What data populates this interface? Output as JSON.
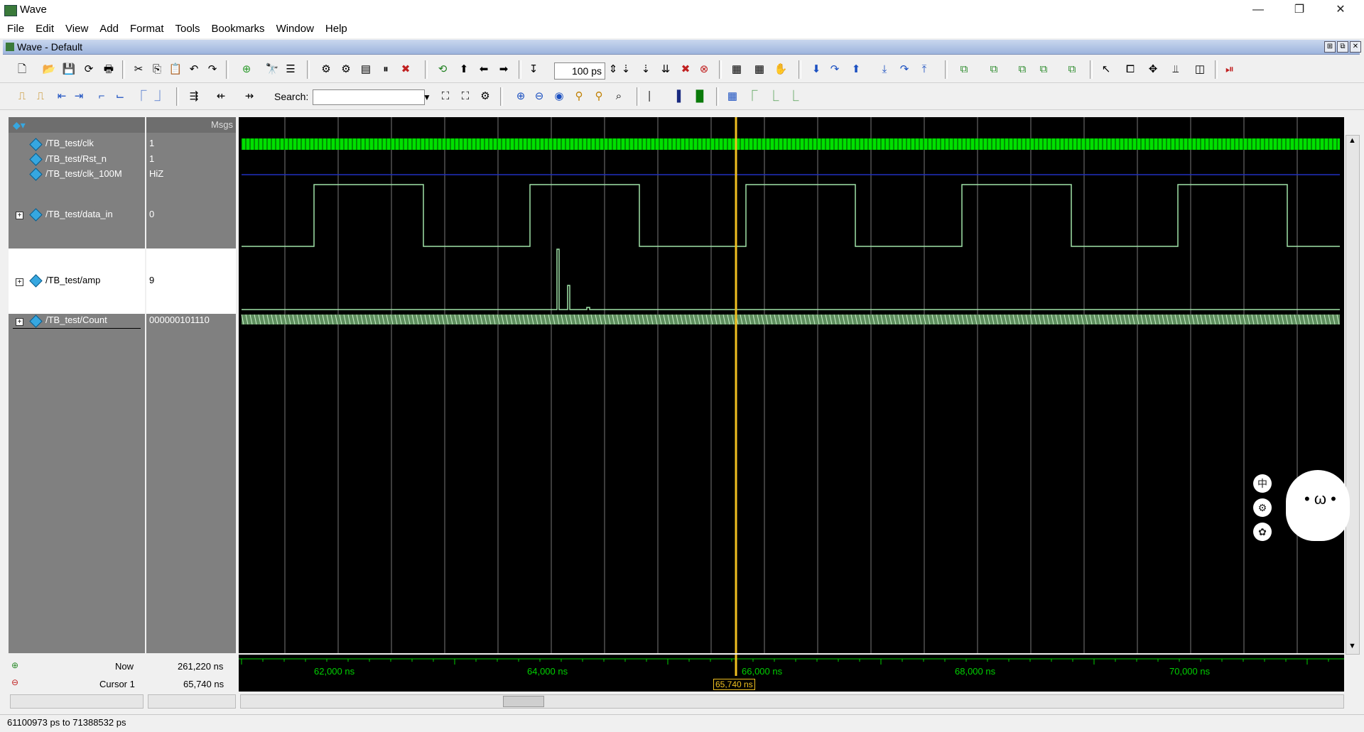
{
  "window": {
    "title": "Wave",
    "minimize": "—",
    "restore": "❐",
    "close": "✕"
  },
  "menu": [
    "File",
    "Edit",
    "View",
    "Add",
    "Format",
    "Tools",
    "Bookmarks",
    "Window",
    "Help"
  ],
  "frame": {
    "title": "Wave - Default"
  },
  "toolbar": {
    "time_value": "100 ps",
    "search_label": "Search:",
    "search_value": ""
  },
  "pane_headers": {
    "values": "Msgs"
  },
  "signals": [
    {
      "name": "/TB_test/clk",
      "value": "1"
    },
    {
      "name": "/TB_test/Rst_n",
      "value": "1"
    },
    {
      "name": "/TB_test/clk_100M",
      "value": "HiZ"
    },
    {
      "name": "/TB_test/data_in",
      "value": "0"
    },
    {
      "name": "/TB_test/amp",
      "value": "9"
    },
    {
      "name": "/TB_test/Count",
      "value": "000000101110"
    }
  ],
  "now": {
    "label": "Now",
    "value": "261,220 ns"
  },
  "cursor": {
    "label": "Cursor 1",
    "value": "65,740 ns",
    "marker": "65,740 ns"
  },
  "time_axis": [
    "62,000 ns",
    "64,000 ns",
    "66,000 ns",
    "68,000 ns",
    "70,000 ns"
  ],
  "status": {
    "range": "61100973 ps to 71388532 ps"
  },
  "side_buttons": [
    "中",
    "⚙",
    "✿"
  ],
  "colors": {
    "clk": "#00e000",
    "wave": "#9fe3a8",
    "cursor": "#f0c020",
    "axis": "#00d000",
    "rst": "#2030c0"
  }
}
